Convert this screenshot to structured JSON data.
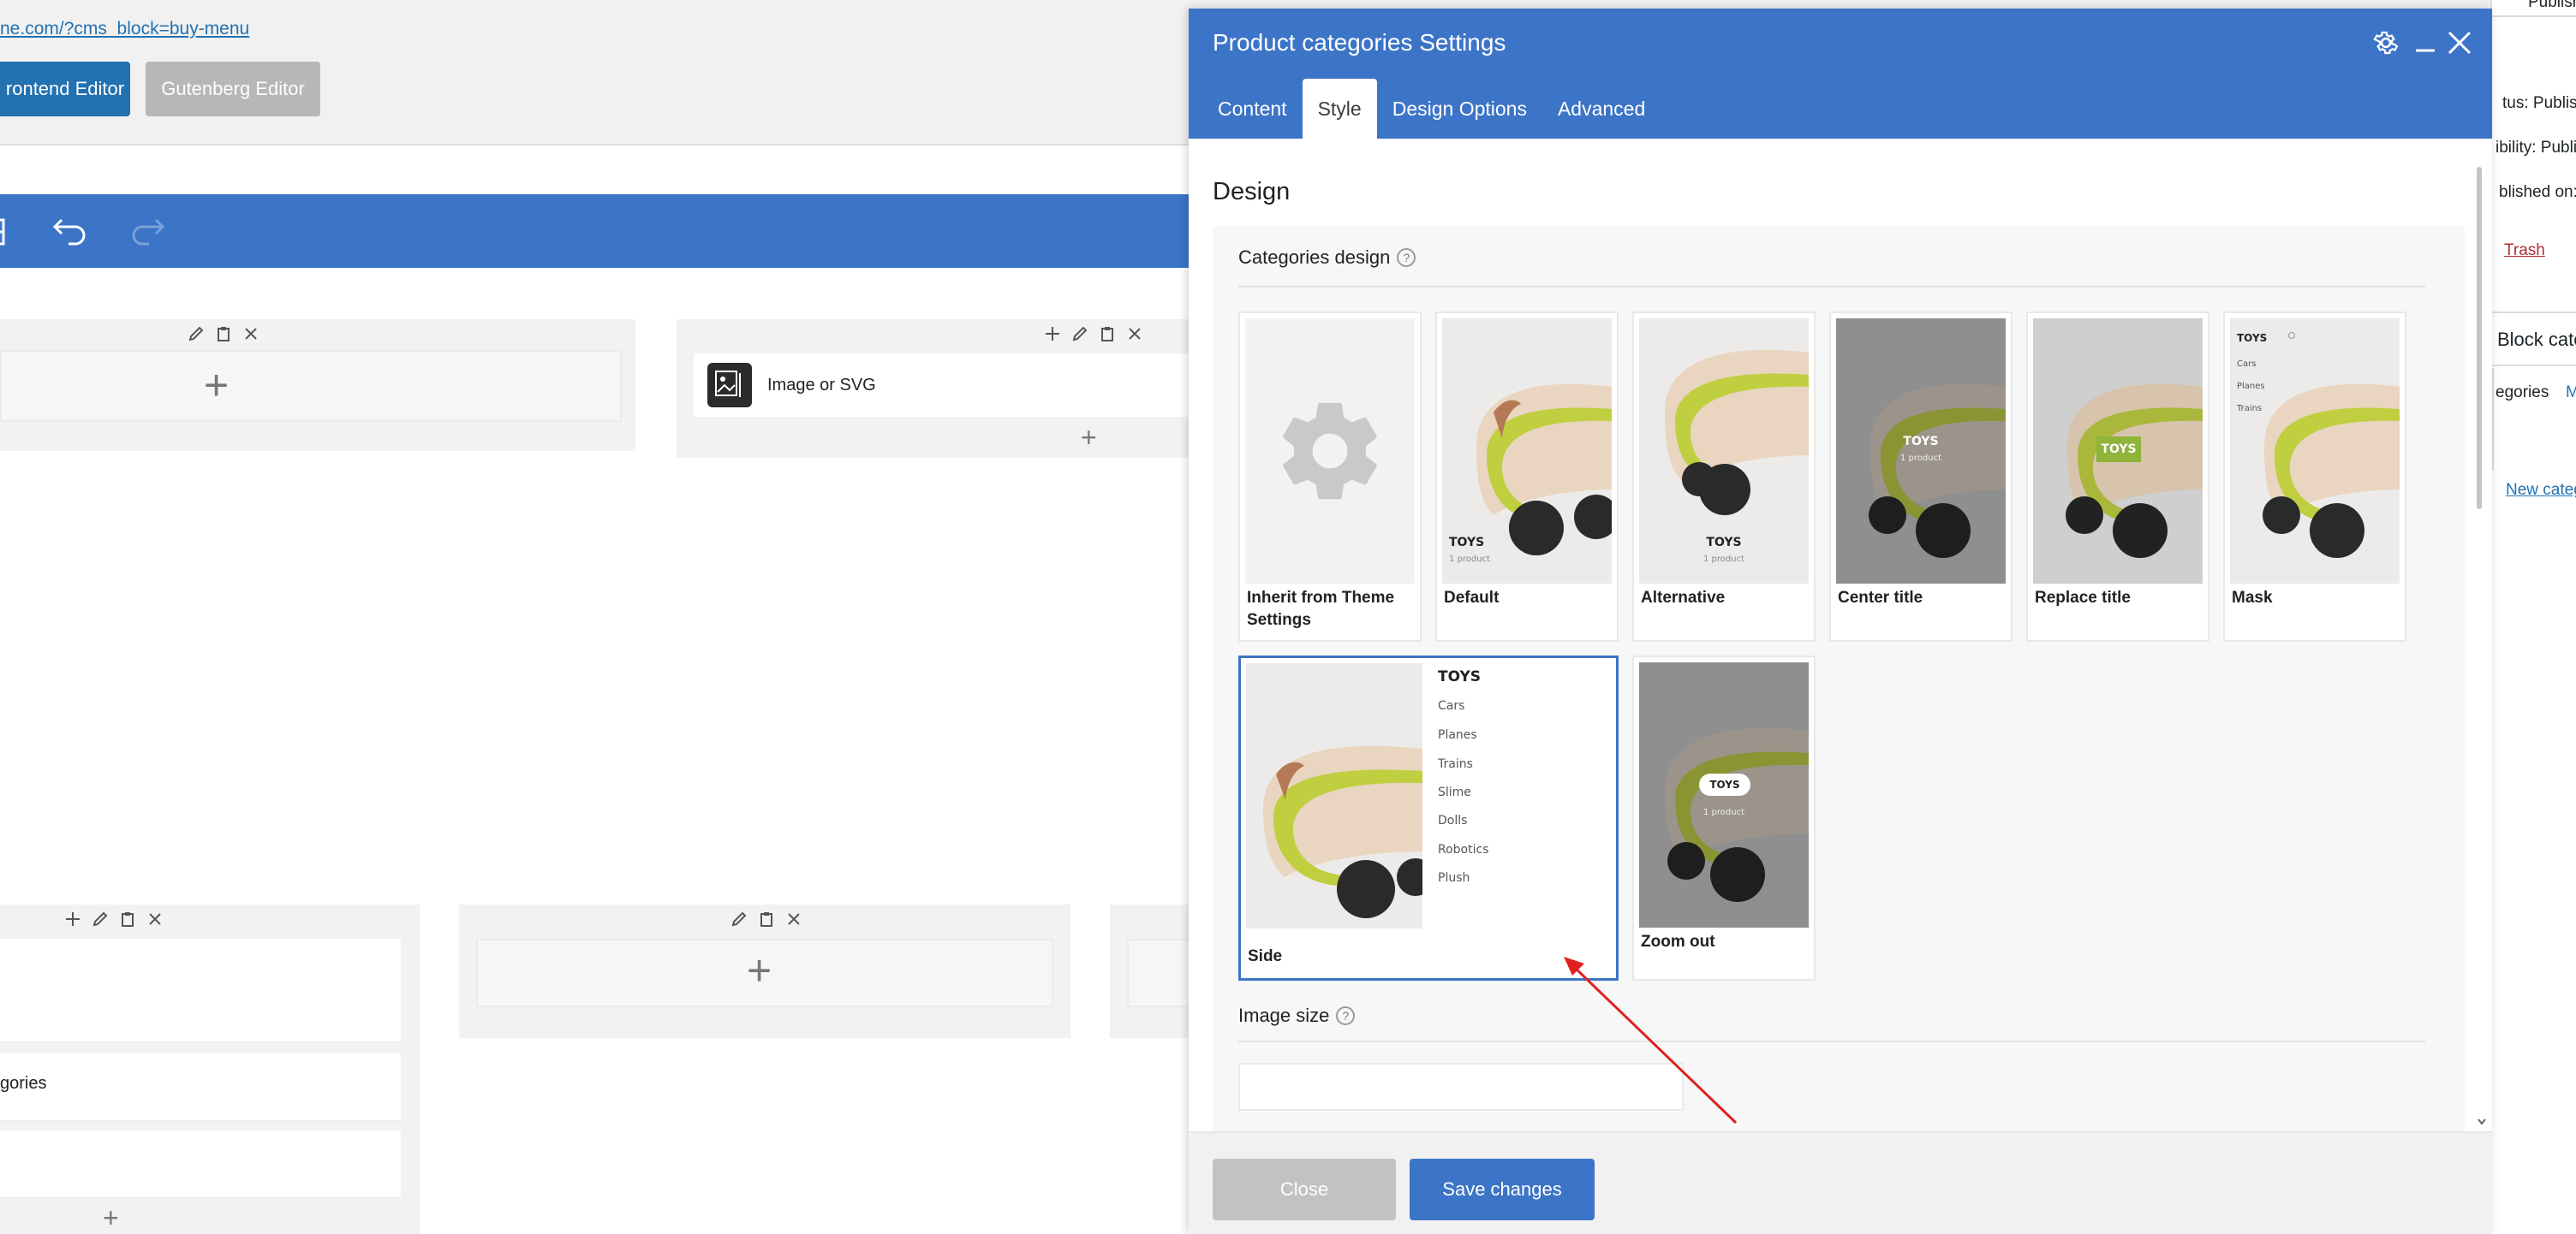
{
  "editor": {
    "url_text": "ne.com/?cms_block=buy-menu",
    "frontend_button": "rontend Editor",
    "gutenberg_button": "Gutenberg Editor"
  },
  "canvas": {
    "image_element_label": "Image or SVG",
    "categories_text": "gories"
  },
  "wp_sidebar": {
    "publish": "Publish",
    "status": "tus: Publish",
    "visibility": "ibility: Publi",
    "published_on": "blished on: ",
    "trash": "Trash",
    "block_title": "Block cate",
    "categories_tab": "egories",
    "m_tab": "M",
    "new_category": "New categ"
  },
  "modal": {
    "title": "Product categories Settings",
    "tabs": [
      "Content",
      "Style",
      "Design Options",
      "Advanced"
    ],
    "active_tab": "Style",
    "section_title": "Design",
    "categories_design_label": "Categories design",
    "image_size_label": "Image size",
    "close_button": "Close",
    "save_button": "Save changes"
  },
  "design_options": [
    {
      "label": "Inherit from Theme Settings",
      "selected": false
    },
    {
      "label": "Default",
      "selected": false
    },
    {
      "label": "Alternative",
      "selected": false
    },
    {
      "label": "Center title",
      "selected": false
    },
    {
      "label": "Replace title",
      "selected": false
    },
    {
      "label": "Mask",
      "selected": false
    },
    {
      "label": "Side",
      "selected": true
    },
    {
      "label": "Zoom out",
      "selected": false
    }
  ],
  "thumb_text": {
    "toys": "TOYS",
    "count": "1 product",
    "side_list": [
      "Cars",
      "Planes",
      "Trains",
      "Slime",
      "Dolls",
      "Robotics",
      "Plush"
    ],
    "mask_list": [
      "Cars",
      "Planes",
      "Trains"
    ]
  },
  "colors": {
    "primary": "#3c74c7",
    "accent_green": "#8fb43a",
    "arrow": "#e02020"
  }
}
